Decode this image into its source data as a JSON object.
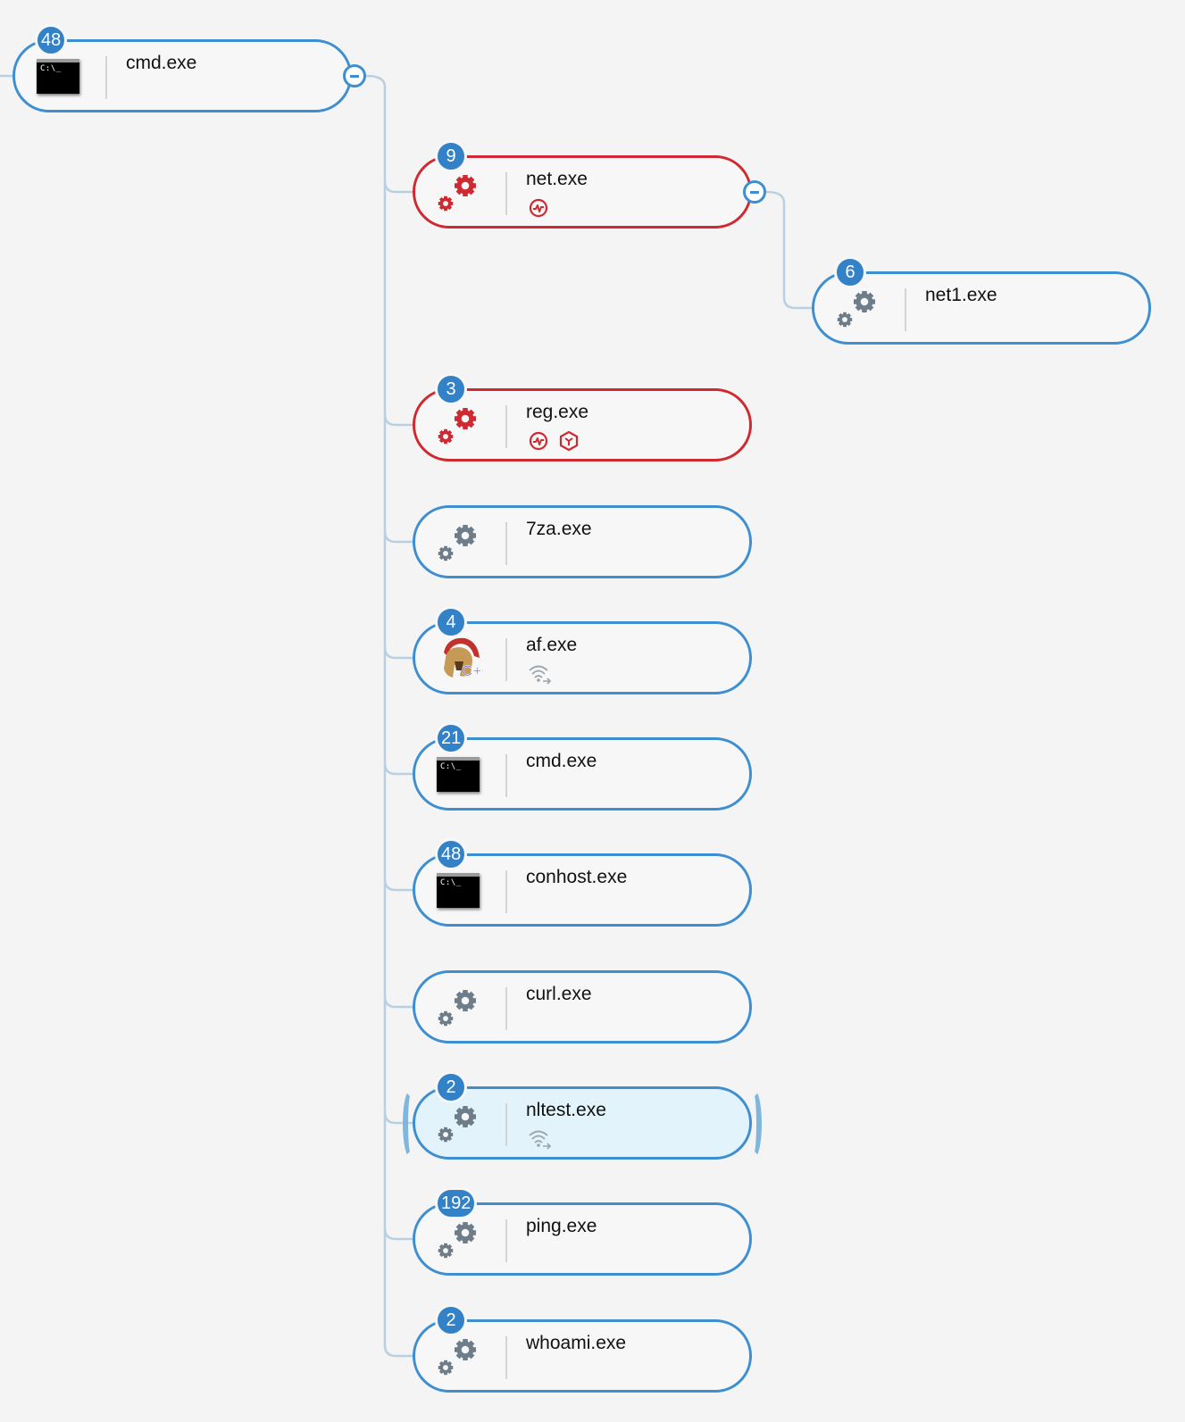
{
  "colors": {
    "node_border": "#3d8fd1",
    "alert_border": "#cf2a31",
    "badge_fill": "#3381c6",
    "gear_neutral": "#6d7d89",
    "gear_alert": "#cf2a31",
    "selected_fill": "#e2f3fb",
    "connector": "#b8d0e0"
  },
  "terminal_prompt": "C:\\_",
  "tree": {
    "root": {
      "name": "cmd.exe",
      "badge": "48",
      "icon": "terminal-icon",
      "state": "normal",
      "expanded": true
    },
    "children": [
      {
        "name": "net.exe",
        "badge": "9",
        "icon": "gears-icon",
        "state": "alert",
        "indicators": [
          "activity-icon"
        ],
        "expanded": true,
        "children": [
          {
            "name": "net1.exe",
            "badge": "6",
            "icon": "gears-icon",
            "state": "normal",
            "indicators": []
          }
        ]
      },
      {
        "name": "reg.exe",
        "badge": "3",
        "icon": "gears-icon",
        "state": "alert",
        "indicators": [
          "activity-icon",
          "shield-icon"
        ]
      },
      {
        "name": "7za.exe",
        "badge": "",
        "icon": "gears-icon",
        "state": "normal",
        "indicators": []
      },
      {
        "name": "af.exe",
        "badge": "4",
        "icon": "spartan-helmet-icon",
        "state": "normal",
        "indicators": [
          "network-outbound-icon"
        ]
      },
      {
        "name": "cmd.exe",
        "badge": "21",
        "icon": "terminal-icon",
        "state": "normal",
        "indicators": []
      },
      {
        "name": "conhost.exe",
        "badge": "48",
        "icon": "terminal-icon",
        "state": "normal",
        "indicators": []
      },
      {
        "name": "curl.exe",
        "badge": "",
        "icon": "gears-icon",
        "state": "normal",
        "indicators": []
      },
      {
        "name": "nltest.exe",
        "badge": "2",
        "icon": "gears-icon",
        "state": "selected",
        "indicators": [
          "network-outbound-icon"
        ]
      },
      {
        "name": "ping.exe",
        "badge": "192",
        "icon": "gears-icon",
        "state": "normal",
        "indicators": []
      },
      {
        "name": "whoami.exe",
        "badge": "2",
        "icon": "gears-icon",
        "state": "normal",
        "indicators": []
      }
    ]
  }
}
